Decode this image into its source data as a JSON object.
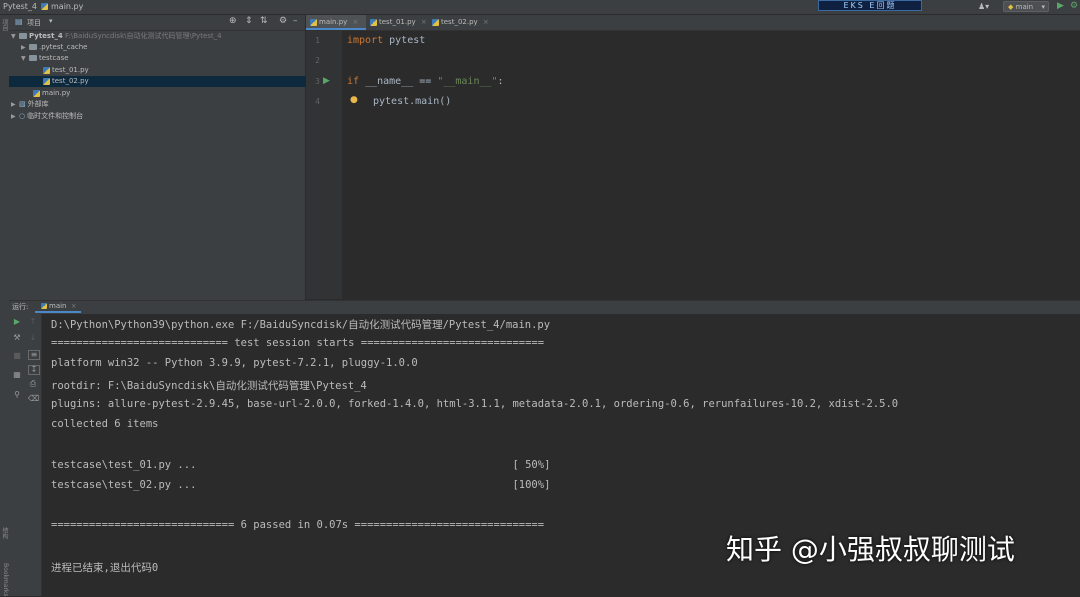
{
  "titlebar": {
    "project_name": "Pytest_4",
    "open_file": "main.py",
    "run_config": "main"
  },
  "project_panel": {
    "view_label": "项目",
    "tree": [
      {
        "label": "Pytest_4",
        "path": "F:\\BaiduSyncdisk\\自动化测试代码管理\\Pytest_4",
        "type": "folder",
        "depth": 0,
        "expanded": true
      },
      {
        "label": ".pytest_cache",
        "type": "folder",
        "depth": 1,
        "expanded": false
      },
      {
        "label": "testcase",
        "type": "folder",
        "depth": 1,
        "expanded": true
      },
      {
        "label": "test_01.py",
        "type": "py",
        "depth": 2
      },
      {
        "label": "test_02.py",
        "type": "py",
        "depth": 2,
        "selected": true
      },
      {
        "label": "main.py",
        "type": "py",
        "depth": 1
      },
      {
        "label": "外部库",
        "type": "lib",
        "depth": 0,
        "expanded": false
      },
      {
        "label": "临时文件和控制台",
        "type": "scratch",
        "depth": 0,
        "expanded": false
      }
    ]
  },
  "editor": {
    "tabs": [
      {
        "label": "main.py",
        "active": true
      },
      {
        "label": "test_01.py",
        "active": false
      },
      {
        "label": "test_02.py",
        "active": false
      }
    ],
    "line_numbers": [
      "1",
      "2",
      "3",
      "4"
    ],
    "code": {
      "l1_kw": "import",
      "l1_rest": " pytest",
      "l3_kw": "if",
      "l3_mid": " __name__ == ",
      "l3_str": "\"__main__\"",
      "l3_end": ":",
      "l4": "pytest.main()"
    }
  },
  "run_panel": {
    "label": "运行:",
    "tab": "main",
    "lines": [
      "D:\\Python\\Python39\\python.exe F:/BaiduSyncdisk/自动化测试代码管理/Pytest_4/main.py",
      "============================ test session starts =============================",
      "platform win32 -- Python 3.9.9, pytest-7.2.1, pluggy-1.0.0",
      "rootdir: F:\\BaiduSyncdisk\\自动化测试代码管理\\Pytest_4",
      "plugins: allure-pytest-2.9.45, base-url-2.0.0, forked-1.4.0, html-3.1.1, metadata-2.0.1, ordering-0.6, rerunfailures-10.2, xdist-2.5.0",
      "collected 6 items",
      "",
      "testcase\\test_01.py ...                                                  [ 50%]",
      "testcase\\test_02.py ...                                                  [100%]",
      "",
      "============================= 6 passed in 0.07s ==============================",
      "",
      "进程已结束,退出代码0"
    ]
  },
  "left_strip": {
    "top_label": "项目",
    "mid_label": "结构",
    "bottom_label": "Bookmarks"
  },
  "watermark": "知乎 @小强叔叔聊测试",
  "logo_text": "EKS E回题"
}
